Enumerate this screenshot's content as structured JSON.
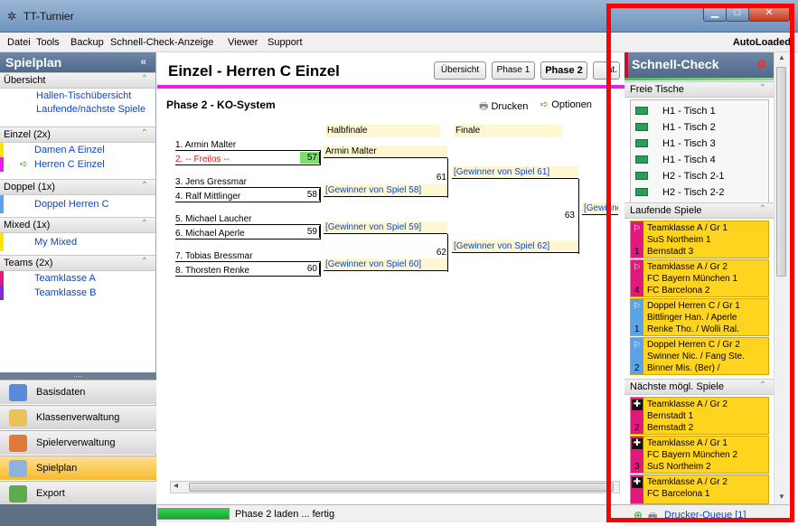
{
  "window": {
    "title": "TT-Turnier",
    "auto_loaded": "AutoLoaded"
  },
  "menu": [
    "Datei",
    "Tools",
    "Backup",
    "Schnell-Check-Anzeige",
    "Viewer",
    "Support"
  ],
  "sidebar": {
    "title": "Spielplan",
    "groups": [
      {
        "label": "Übersicht",
        "items": [
          "Hallen-Tischübersicht",
          "Laufende/nächste Spiele"
        ]
      },
      {
        "label": "Einzel (2x)",
        "items": [
          "Damen A Einzel",
          "Herren C Einzel"
        ]
      },
      {
        "label": "Doppel (1x)",
        "items": [
          "Doppel Herren C"
        ]
      },
      {
        "label": "Mixed (1x)",
        "items": [
          "My Mixed"
        ]
      },
      {
        "label": "Teams (2x)",
        "items": [
          "Teamklasse A",
          "Teamklasse B"
        ]
      }
    ],
    "nav": [
      "Basisdaten",
      "Klassenverwaltung",
      "Spielerverwaltung",
      "Spielplan",
      "Export"
    ],
    "dots": "....."
  },
  "main": {
    "title": "Einzel - Herren C Einzel",
    "tabs": [
      "Übersicht",
      "Phase 1",
      "Phase 2",
      "at."
    ],
    "phase_title": "Phase 2 - KO-System",
    "print_label": "Drucken",
    "options_label": "Optionen",
    "bracket_headers": [
      "Halbfinale",
      "Finale"
    ],
    "players": [
      "1.  Armin Malter",
      "2.  -- Freilos --",
      "3.  Jens Gressmar",
      "4.  Ralf Mittlinger",
      "5.  Michael Laucher",
      "6.  Michael Aperle",
      "7.  Tobias Bressmar",
      "8.  Thorsten Renke"
    ],
    "r1": [
      {
        "name": "Armin Malter",
        "score": "57",
        "winner": "Armin Malter"
      },
      {
        "name": "Ralf Mittlinger",
        "score": "58",
        "winner": "[Gewinner von Spiel 58]"
      },
      {
        "name": "Michael Aperle",
        "score": "59",
        "winner": "[Gewinner von Spiel 59]"
      },
      {
        "name": "Thorsten Renke",
        "score": "60",
        "winner": "[Gewinner von Spiel 60]"
      }
    ],
    "r2": [
      {
        "score": "61",
        "winner": "[Gewinner von Spiel 61]"
      },
      {
        "score": "62",
        "winner": "[Gewinner von Spiel 62]"
      }
    ],
    "final": {
      "score": "63",
      "winner": "[Gewinne"
    },
    "status": "Phase 2 laden ... fertig"
  },
  "schnell": {
    "title": "Schnell-Check",
    "free_title": "Freie Tische",
    "free": [
      "H1 - Tisch 1",
      "H1 - Tisch 2",
      "H1 - Tisch 3",
      "H1 - Tisch 4",
      "H2 - Tisch 2-1",
      "H2 - Tisch 2-2"
    ],
    "running_title": "Laufende Spiele",
    "running": [
      {
        "lines": [
          "Teamklasse A / Gr 1",
          "SuS Northeim 1",
          "Bernstadt 3"
        ],
        "num": "1",
        "color": "#e0197d"
      },
      {
        "lines": [
          "Teamklasse A / Gr 2",
          "FC Bayern München 1",
          "FC Barcelona 2"
        ],
        "num": "4",
        "color": "#e0197d"
      },
      {
        "lines": [
          "Doppel Herren C / Gr 1",
          "Bittlinger Han. / Aperle",
          "Renke Tho. / Wolli Ral."
        ],
        "num": "1",
        "color": "#5aa3e8"
      },
      {
        "lines": [
          "Doppel Herren C / Gr 2",
          "Swinner Nic. / Fang Ste.",
          "Binner Mis. (Ber) /"
        ],
        "num": "2",
        "color": "#5aa3e8"
      }
    ],
    "next_title": "Nächste mögl. Spiele",
    "next": [
      {
        "lines": [
          "Teamklasse A / Gr 2",
          "Bernstadt 1",
          "Bernstadt 2"
        ],
        "num": "2",
        "color": "#e0197d"
      },
      {
        "lines": [
          "Teamklasse A / Gr 1",
          "FC Bayern München 2",
          "SuS Northeim 2"
        ],
        "num": "3",
        "color": "#e0197d"
      },
      {
        "lines": [
          "Teamklasse A / Gr 2",
          "FC Barcelona 1"
        ],
        "num": "",
        "color": "#e0197d"
      }
    ],
    "queue": "Drucker-Queue [1]"
  },
  "colors": {
    "accent": "#e81fe6",
    "highlight": "#ff0000",
    "card": "#ffd41f"
  }
}
